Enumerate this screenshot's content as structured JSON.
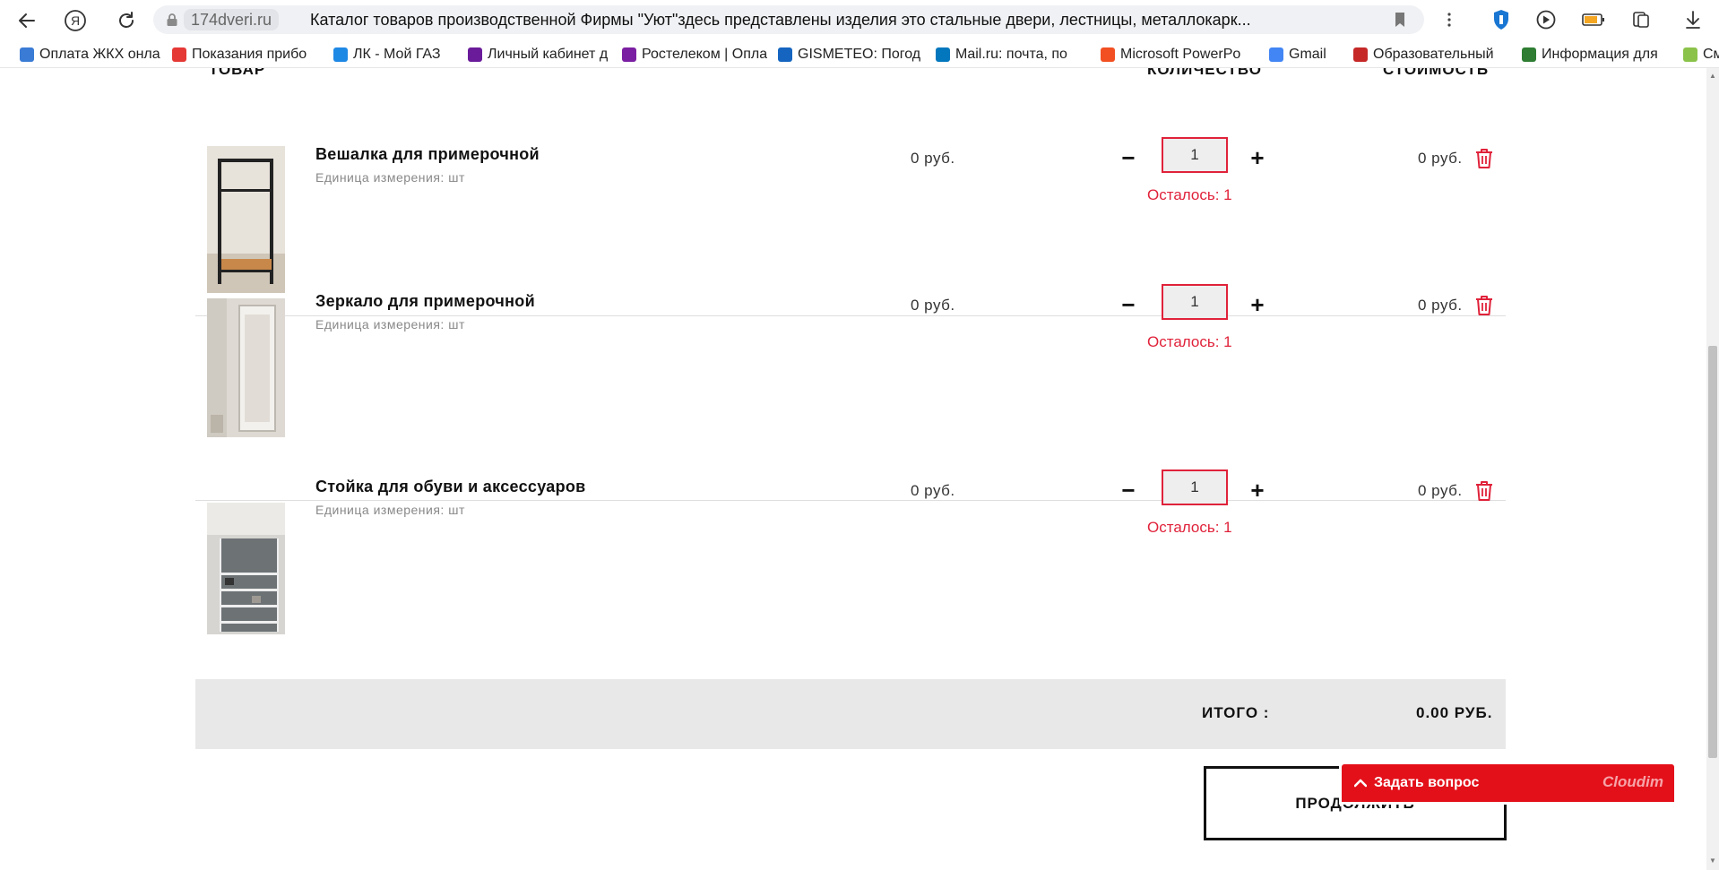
{
  "browser": {
    "domain": "174dveri.ru",
    "tab_title": "Каталог товаров производственной Фирмы \"Уют\"здесь представлены изделия это стальные двери, лестницы, металлокарк..."
  },
  "bookmarks": [
    {
      "label": "Оплата ЖКХ онла",
      "color": "#3a7bd5"
    },
    {
      "label": "Показания прибо",
      "color": "#e53935"
    },
    {
      "label": "ЛК - Мой ГАЗ",
      "color": "#1e88e5"
    },
    {
      "label": "Личный кабинет д",
      "color": "#6a1b9a"
    },
    {
      "label": "Ростелеком | Опла",
      "color": "#7b1fa2"
    },
    {
      "label": "GISMETEO: Погод",
      "color": "#1565c0"
    },
    {
      "label": "Mail.ru: почта, по",
      "color": "#0277bd"
    },
    {
      "label": "Microsoft PowerPo",
      "color": "#f25022"
    },
    {
      "label": "Gmail",
      "color": "#4285f4"
    },
    {
      "label": "Образовательный",
      "color": "#c62828"
    },
    {
      "label": "Информация для",
      "color": "#2e7d32"
    },
    {
      "label": "См",
      "color": "#8bc34a"
    }
  ],
  "table": {
    "headers": {
      "product": "ТОВАР",
      "quantity": "КОЛИЧЕСТВО",
      "cost": "СТОИМОСТЬ"
    },
    "items": [
      {
        "name": "Вешалка для примерочной",
        "unit": "Единица измерения: шт",
        "price": "0 руб.",
        "qty": "1",
        "remaining": "Осталось: 1",
        "total": "0 руб."
      },
      {
        "name": "Зеркало для примерочной",
        "unit": "Единица измерения: шт",
        "price": "0 руб.",
        "qty": "1",
        "remaining": "Осталось: 1",
        "total": "0 руб."
      },
      {
        "name": "Стойка для обуви и аксессуаров",
        "unit": "Единица измерения: шт",
        "price": "0 руб.",
        "qty": "1",
        "remaining": "Осталось: 1",
        "total": "0 руб."
      }
    ],
    "qty_minus": "−",
    "qty_plus": "+"
  },
  "summary": {
    "label": "ИТОГО :",
    "value": "0.00 РУБ."
  },
  "continue_label": "ПРОДОЛЖИТЬ",
  "chat_widget": {
    "label": "Задать вопрос",
    "brand": "Cloudim",
    "color": "#e3101a"
  },
  "colors": {
    "accent": "#e0223a"
  }
}
